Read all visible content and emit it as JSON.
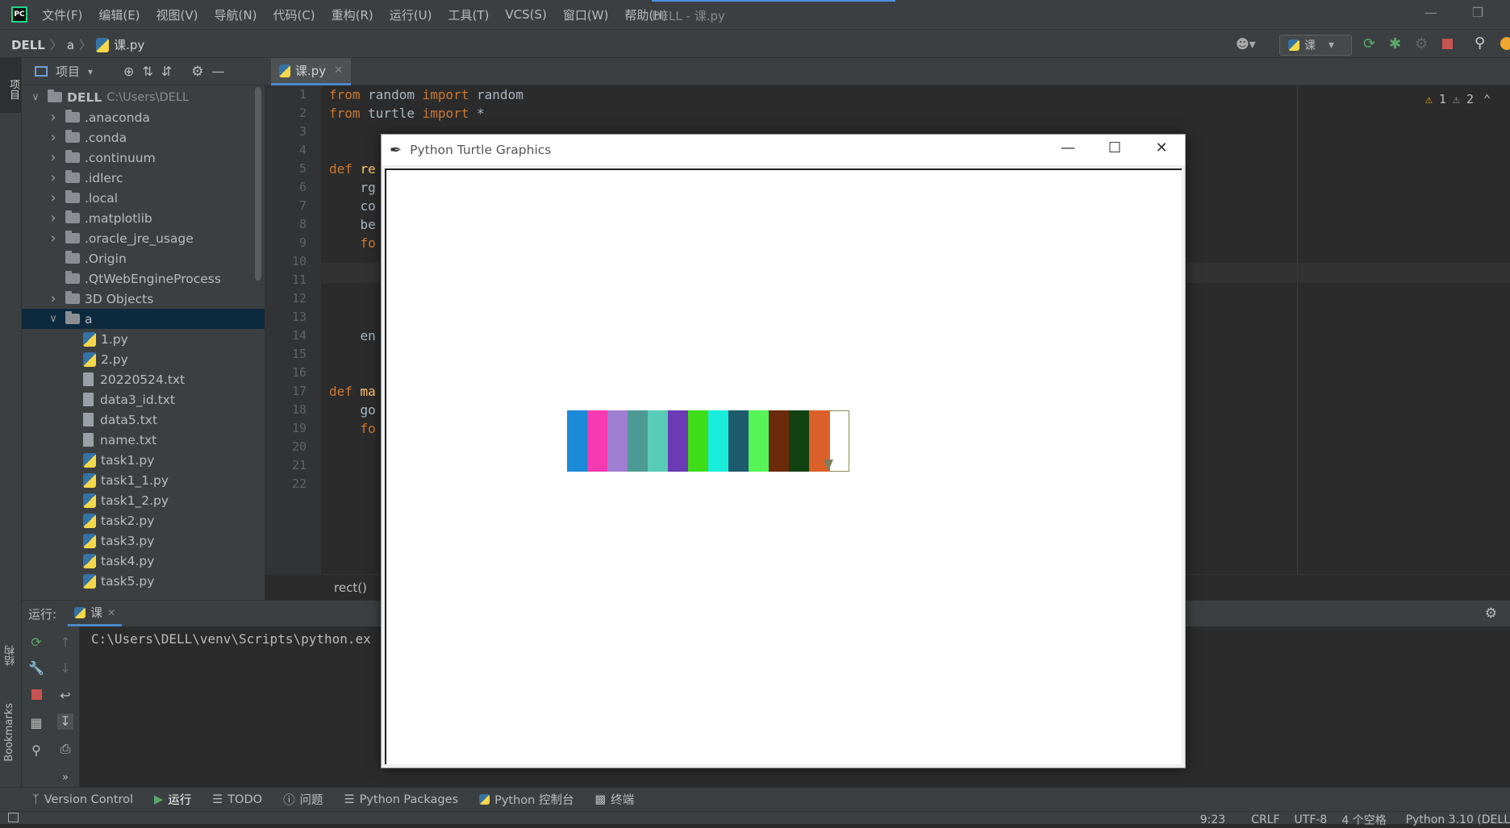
{
  "app": {
    "logo_text": "PC",
    "window_title": "DELL - 课.py",
    "menu": [
      "文件(F)",
      "编辑(E)",
      "视图(V)",
      "导航(N)",
      "代码(C)",
      "重构(R)",
      "运行(U)",
      "工具(T)",
      "VCS(S)",
      "窗口(W)",
      "帮助(H)"
    ]
  },
  "navbar": {
    "breadcrumb": [
      "DELL",
      "a",
      "课.py"
    ],
    "run_config": "课"
  },
  "project": {
    "title": "项目",
    "root_name": "DELL",
    "root_path": "C:\\Users\\DELL",
    "items": [
      {
        "name": ".anaconda",
        "type": "folder",
        "depth": 1,
        "expand": "collapsed"
      },
      {
        "name": ".conda",
        "type": "folder",
        "depth": 1,
        "expand": "collapsed"
      },
      {
        "name": ".continuum",
        "type": "folder",
        "depth": 1,
        "expand": "collapsed"
      },
      {
        "name": ".idlerc",
        "type": "folder",
        "depth": 1,
        "expand": "collapsed"
      },
      {
        "name": ".local",
        "type": "folder",
        "depth": 1,
        "expand": "collapsed"
      },
      {
        "name": ".matplotlib",
        "type": "folder",
        "depth": 1,
        "expand": "collapsed"
      },
      {
        "name": ".oracle_jre_usage",
        "type": "folder",
        "depth": 1,
        "expand": "collapsed"
      },
      {
        "name": ".Origin",
        "type": "folder",
        "depth": 1,
        "expand": "none"
      },
      {
        "name": ".QtWebEngineProcess",
        "type": "folder",
        "depth": 1,
        "expand": "none"
      },
      {
        "name": "3D Objects",
        "type": "folder",
        "depth": 1,
        "expand": "collapsed"
      },
      {
        "name": "a",
        "type": "folder",
        "depth": 1,
        "expand": "expanded",
        "selected": true
      },
      {
        "name": "1.py",
        "type": "py",
        "depth": 2
      },
      {
        "name": "2.py",
        "type": "py",
        "depth": 2
      },
      {
        "name": "20220524.txt",
        "type": "txt",
        "depth": 2
      },
      {
        "name": "data3_id.txt",
        "type": "txt",
        "depth": 2
      },
      {
        "name": "data5.txt",
        "type": "txt",
        "depth": 2
      },
      {
        "name": "name.txt",
        "type": "txt",
        "depth": 2
      },
      {
        "name": "task1.py",
        "type": "py",
        "depth": 2
      },
      {
        "name": "task1_1.py",
        "type": "py",
        "depth": 2
      },
      {
        "name": "task1_2.py",
        "type": "py",
        "depth": 2
      },
      {
        "name": "task2.py",
        "type": "py",
        "depth": 2
      },
      {
        "name": "task3.py",
        "type": "py",
        "depth": 2
      },
      {
        "name": "task4.py",
        "type": "py",
        "depth": 2
      },
      {
        "name": "task5.py",
        "type": "py",
        "depth": 2
      }
    ]
  },
  "editor": {
    "tab_label": "课.py",
    "line_numbers": [
      "1",
      "2",
      "3",
      "4",
      "5",
      "6",
      "7",
      "8",
      "9",
      "10",
      "11",
      "12",
      "13",
      "14",
      "15",
      "16",
      "17",
      "18",
      "19",
      "20",
      "21",
      "22"
    ],
    "code": [
      {
        "line": 1,
        "parts": [
          [
            "kw",
            "from"
          ],
          [
            "id",
            " random "
          ],
          [
            "kw",
            "import"
          ],
          [
            "id",
            " random"
          ]
        ]
      },
      {
        "line": 2,
        "parts": [
          [
            "kw",
            "from"
          ],
          [
            "id",
            " turtle "
          ],
          [
            "kw",
            "import"
          ],
          [
            "id",
            " *"
          ]
        ]
      },
      {
        "line": 5,
        "parts": [
          [
            "kw",
            "def"
          ],
          [
            "fn",
            " re"
          ]
        ]
      },
      {
        "line": 6,
        "parts": [
          [
            "id",
            "    rg"
          ]
        ]
      },
      {
        "line": 7,
        "parts": [
          [
            "id",
            "    co"
          ]
        ]
      },
      {
        "line": 8,
        "parts": [
          [
            "id",
            "    be"
          ]
        ]
      },
      {
        "line": 9,
        "parts": [
          [
            "kw",
            "    fo"
          ]
        ]
      },
      {
        "line": 14,
        "parts": [
          [
            "id",
            "    en"
          ]
        ]
      },
      {
        "line": 17,
        "parts": [
          [
            "kw",
            "def"
          ],
          [
            "fn",
            " ma"
          ]
        ]
      },
      {
        "line": 18,
        "parts": [
          [
            "id",
            "    go"
          ]
        ]
      },
      {
        "line": 19,
        "parts": [
          [
            "kw",
            "    fo"
          ]
        ]
      }
    ],
    "warnings": "1",
    "weak_warnings": "2",
    "breadcrumb": "rect()"
  },
  "run": {
    "label": "运行:",
    "tab_label": "课",
    "console_line": "C:\\Users\\DELL\\venv\\Scripts\\python.ex"
  },
  "bottom_tools": [
    "Version Control",
    "运行",
    "TODO",
    "问题",
    "Python Packages",
    "Python 控制台",
    "终端"
  ],
  "status": [
    "9:23",
    "CRLF",
    "UTF-8",
    "4 个空格",
    "Python 3.10 (DELL"
  ],
  "turtle": {
    "title": "Python Turtle Graphics",
    "stripe_colors": [
      "#1a8ad9",
      "#f53ab2",
      "#a07ed1",
      "#4d9a94",
      "#58ccb6",
      "#6a3bb4",
      "#3fdd17",
      "#19eedd",
      "#1c5a6c",
      "#56f456",
      "#6b2a0a",
      "#124212",
      "#dc602a",
      "#ffffff"
    ]
  }
}
